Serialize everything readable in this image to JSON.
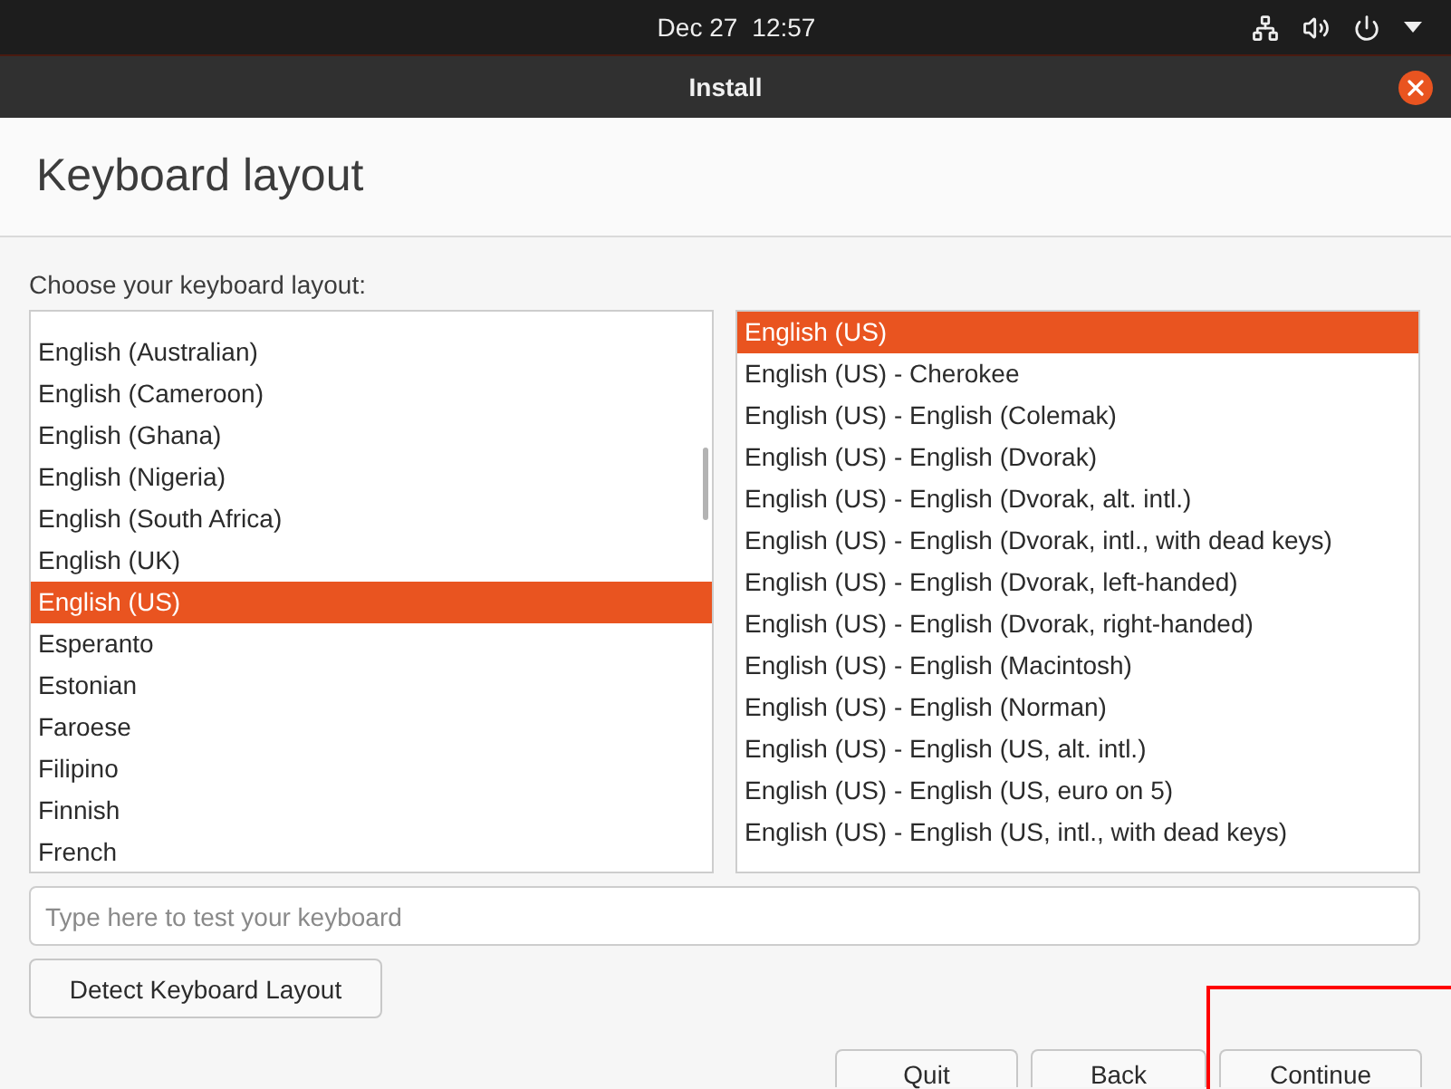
{
  "top_bar": {
    "date": "Dec 27",
    "time": "12:57"
  },
  "window": {
    "title": "Install"
  },
  "page": {
    "heading": "Keyboard layout",
    "prompt": "Choose your keyboard layout:"
  },
  "layouts": [
    {
      "label": "English (Australian)",
      "selected": false
    },
    {
      "label": "English (Cameroon)",
      "selected": false
    },
    {
      "label": "English (Ghana)",
      "selected": false
    },
    {
      "label": "English (Nigeria)",
      "selected": false
    },
    {
      "label": "English (South Africa)",
      "selected": false
    },
    {
      "label": "English (UK)",
      "selected": false
    },
    {
      "label": "English (US)",
      "selected": true
    },
    {
      "label": "Esperanto",
      "selected": false
    },
    {
      "label": "Estonian",
      "selected": false
    },
    {
      "label": "Faroese",
      "selected": false
    },
    {
      "label": "Filipino",
      "selected": false
    },
    {
      "label": "Finnish",
      "selected": false
    },
    {
      "label": "French",
      "selected": false
    }
  ],
  "variants": [
    {
      "label": "English (US)",
      "selected": true
    },
    {
      "label": "English (US) - Cherokee",
      "selected": false
    },
    {
      "label": "English (US) - English (Colemak)",
      "selected": false
    },
    {
      "label": "English (US) - English (Dvorak)",
      "selected": false
    },
    {
      "label": "English (US) - English (Dvorak, alt. intl.)",
      "selected": false
    },
    {
      "label": "English (US) - English (Dvorak, intl., with dead keys)",
      "selected": false
    },
    {
      "label": "English (US) - English (Dvorak, left-handed)",
      "selected": false
    },
    {
      "label": "English (US) - English (Dvorak, right-handed)",
      "selected": false
    },
    {
      "label": "English (US) - English (Macintosh)",
      "selected": false
    },
    {
      "label": "English (US) - English (Norman)",
      "selected": false
    },
    {
      "label": "English (US) - English (US, alt. intl.)",
      "selected": false
    },
    {
      "label": "English (US) - English (US, euro on 5)",
      "selected": false
    },
    {
      "label": "English (US) - English (US, intl., with dead keys)",
      "selected": false
    }
  ],
  "test_field": {
    "placeholder": "Type here to test your keyboard"
  },
  "detect_button": "Detect Keyboard Layout",
  "buttons": [
    "Quit",
    "Back",
    "Continue"
  ]
}
